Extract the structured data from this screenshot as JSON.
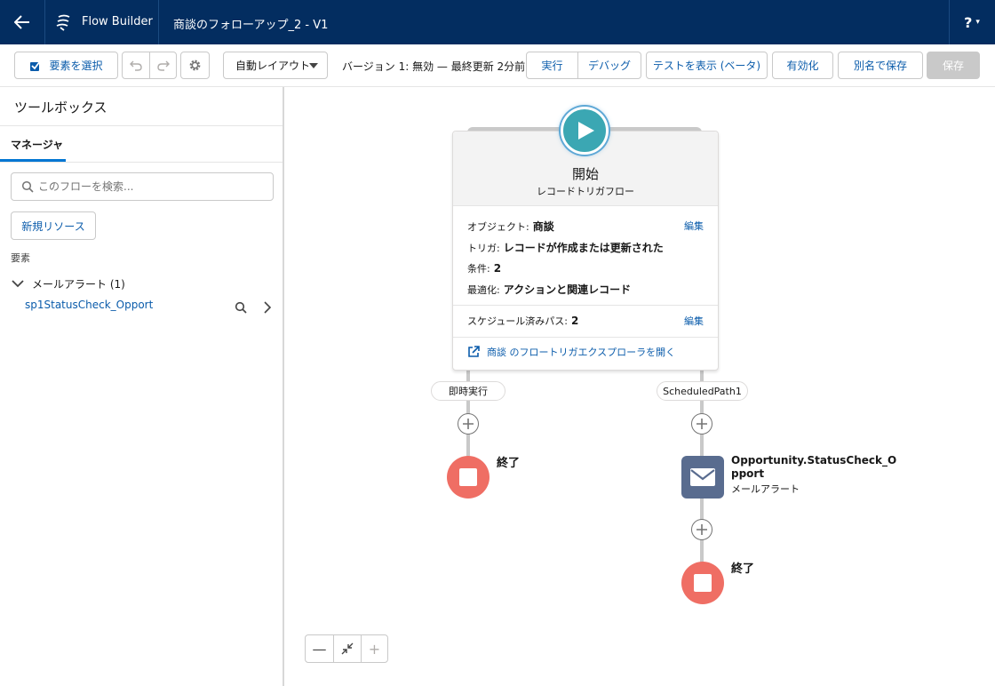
{
  "header": {
    "app_name": "Flow Builder",
    "flow_title": "商談のフォローアップ_2 - V1",
    "help_label": "?"
  },
  "toolbar": {
    "select_elements": "要素を選択",
    "layout_select": "自動レイアウト",
    "version_status": "バージョン 1: 無効 — 最終更新 2分前",
    "run": "実行",
    "debug": "デバッグ",
    "view_tests": "テストを表示 (ベータ)",
    "activate": "有効化",
    "save_as": "別名で保存",
    "save": "保存"
  },
  "toolbox": {
    "title": "ツールボックス",
    "tab_manager": "マネージャ",
    "search_placeholder": "このフローを検索...",
    "new_resource": "新規リソース",
    "section_elements": "要素",
    "group_label": "メールアラート (1)",
    "item_label": "sp1StatusCheck_Opport"
  },
  "start": {
    "title": "開始",
    "subtitle": "レコードトリガフロー",
    "object_label": "オブジェクト:",
    "object_value": "商談",
    "trigger_label": "トリガ:",
    "trigger_value": "レコードが作成または更新された",
    "condition_label": "条件:",
    "condition_value": "2",
    "optimize_label": "最適化:",
    "optimize_value": "アクションと関連レコード",
    "edit": "編集",
    "scheduled_label": "スケジュール済みパス:",
    "scheduled_value": "2",
    "explorer_link": "商談 のフロートリガエクスプローラを開く"
  },
  "paths": {
    "immediate": "即時実行",
    "scheduled": "ScheduledPath1"
  },
  "nodes": {
    "end_label": "終了",
    "mail_name": "Opportunity.StatusCheck_Opport",
    "mail_type": "メールアラート"
  },
  "zoom": {
    "zoom_out": "—",
    "zoom_in": "+"
  }
}
